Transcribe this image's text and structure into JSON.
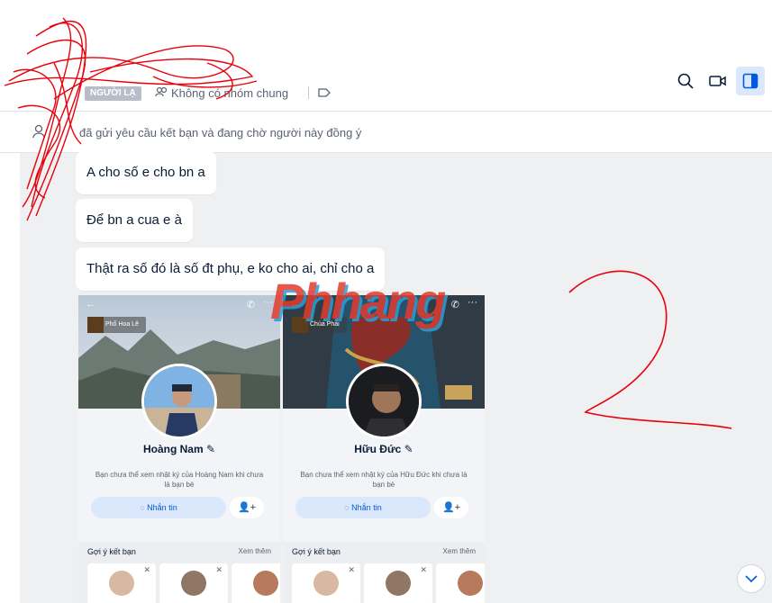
{
  "header": {
    "badge": "NGƯỜI LẠ",
    "group_info": "Không có nhóm chung",
    "icons": [
      "search-icon",
      "video-call-icon",
      "sidebar-toggle-icon"
    ]
  },
  "notice": {
    "text": "đã gửi yêu cầu kết bạn và đang chờ người này đồng ý"
  },
  "messages": [
    "A cho số e cho bn a",
    "Để bn a cua e à",
    "Thật ra số đó là số đt phụ, e ko cho ai, chỉ cho a"
  ],
  "profiles": [
    {
      "music": "Phố Hoa Lê",
      "name": "Hoàng Nam",
      "desc": "Bạn chưa thể xem nhật ký của Hoàng Nam khi chưa là bạn bè",
      "message_btn": "Nhắn tin",
      "suggest_label": "Gợi ý kết bạn",
      "see_more": "Xem thêm"
    },
    {
      "music": "Chùa Phải",
      "name": "Hữu Đức",
      "desc": "Bạn chưa thể xem nhật ký của Hữu Đức khi chưa là bạn bè",
      "message_btn": "Nhắn tin",
      "suggest_label": "Gợi ý kết bạn",
      "see_more": "Xem thêm"
    }
  ],
  "watermark": "Phhang",
  "annotation": "2",
  "colors": {
    "accent": "#005ae0",
    "chat_bg": "#eef0f1",
    "scribble": "#e8000b"
  }
}
